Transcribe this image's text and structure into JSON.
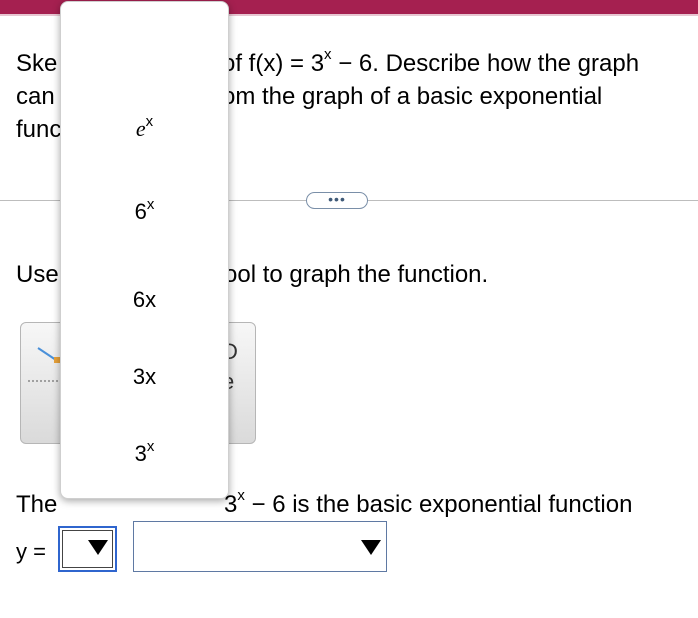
{
  "header": {
    "accent_color": "#a52050"
  },
  "question": {
    "line1_left": "Ske",
    "line2_left": "can",
    "line3_left": "func",
    "line1_right_pre": "of f(x) = 3",
    "line1_right_sup": "x",
    "line1_right_post": " − 6. Describe how the graph",
    "line2_right": "om the graph of a basic exponential"
  },
  "more_button": {
    "label": "•••"
  },
  "instruction": {
    "left": "Use",
    "right": "ool to graph the function."
  },
  "graph_tool": {
    "glyph1": "D",
    "glyph2": "e"
  },
  "answer": {
    "left": "The",
    "right_pre": "3",
    "right_sup": "x",
    "right_post": " − 6 is the basic exponential function",
    "y_label": "y ="
  },
  "dropdown": {
    "options": [
      {
        "base": "e",
        "sup": "x"
      },
      {
        "base": "6",
        "sup": "x"
      },
      {
        "label": "6x"
      },
      {
        "label": "3x"
      },
      {
        "base": "3",
        "sup": "x"
      }
    ]
  }
}
